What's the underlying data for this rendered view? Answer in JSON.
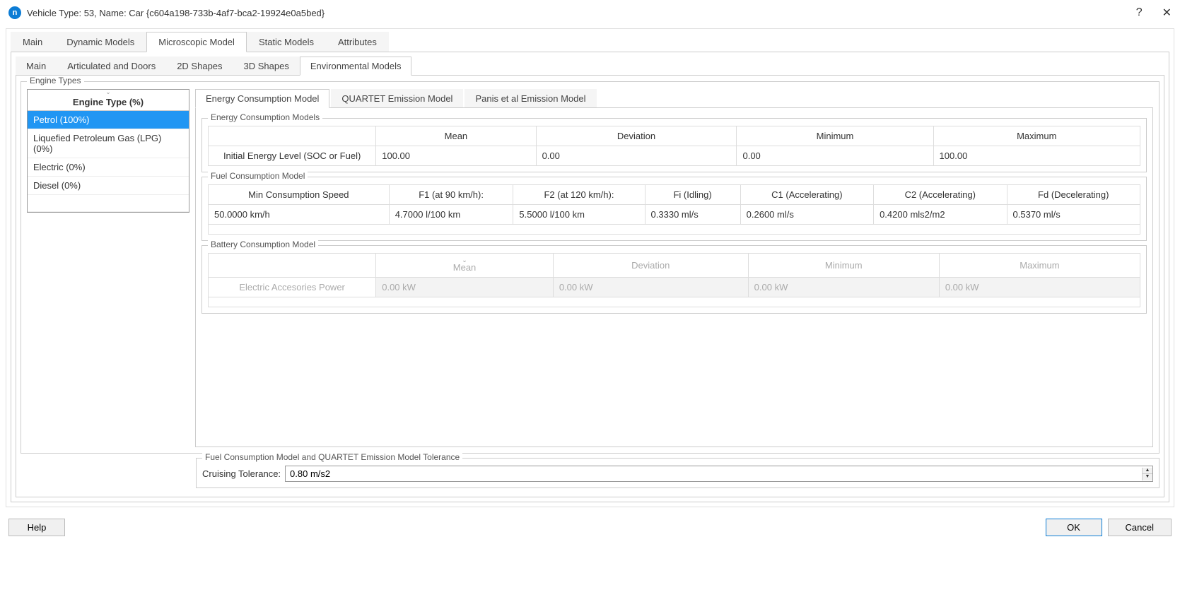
{
  "titlebar": {
    "icon_letter": "n",
    "title": "Vehicle Type: 53, Name: Car  {c604a198-733b-4af7-bca2-19924e0a5bed}",
    "help": "?",
    "close": "✕"
  },
  "main_tabs": [
    "Main",
    "Dynamic Models",
    "Microscopic Model",
    "Static Models",
    "Attributes"
  ],
  "main_tabs_active": 2,
  "sub_tabs": [
    "Main",
    "Articulated and Doors",
    "2D Shapes",
    "3D Shapes",
    "Environmental Models"
  ],
  "sub_tabs_active": 4,
  "engine_types": {
    "fieldset_label": "Engine Types",
    "header": "Engine Type (%)",
    "rows": [
      "Petrol (100%)",
      "Liquefied Petroleum Gas (LPG) (0%)",
      "Electric (0%)",
      "Diesel (0%)"
    ],
    "selected": 0
  },
  "model_tabs": [
    "Energy Consumption Model",
    "QUARTET Emission Model",
    "Panis et al Emission Model"
  ],
  "model_tabs_active": 0,
  "energy_consumption": {
    "fieldset_label": "Energy Consumption Models",
    "cols": [
      "Mean",
      "Deviation",
      "Minimum",
      "Maximum"
    ],
    "row_label": "Initial Energy Level (SOC or Fuel)",
    "values": [
      "100.00",
      "0.00",
      "0.00",
      "100.00"
    ]
  },
  "fuel_consumption": {
    "fieldset_label": "Fuel Consumption Model",
    "cols": [
      "Min Consumption Speed",
      "F1 (at 90 km/h):",
      "F2 (at 120 km/h):",
      "Fi (Idling)",
      "C1 (Accelerating)",
      "C2 (Accelerating)",
      "Fd (Decelerating)"
    ],
    "values": [
      "50.0000  km/h",
      "4.7000  l/100 km",
      "5.5000  l/100 km",
      "0.3330  ml/s",
      "0.2600  ml/s",
      "0.4200  mls2/m2",
      "0.5370  ml/s"
    ]
  },
  "battery_consumption": {
    "fieldset_label": "Battery Consumption Model",
    "cols": [
      "Mean",
      "Deviation",
      "Minimum",
      "Maximum"
    ],
    "row_label": "Electric Accesories Power",
    "values": [
      "0.00 kW",
      "0.00 kW",
      "0.00 kW",
      "0.00 kW"
    ]
  },
  "tolerance": {
    "fieldset_label": "Fuel Consumption Model and QUARTET Emission Model Tolerance",
    "label": "Cruising Tolerance:",
    "value": "0.80 m/s2"
  },
  "footer": {
    "help": "Help",
    "ok": "OK",
    "cancel": "Cancel"
  }
}
